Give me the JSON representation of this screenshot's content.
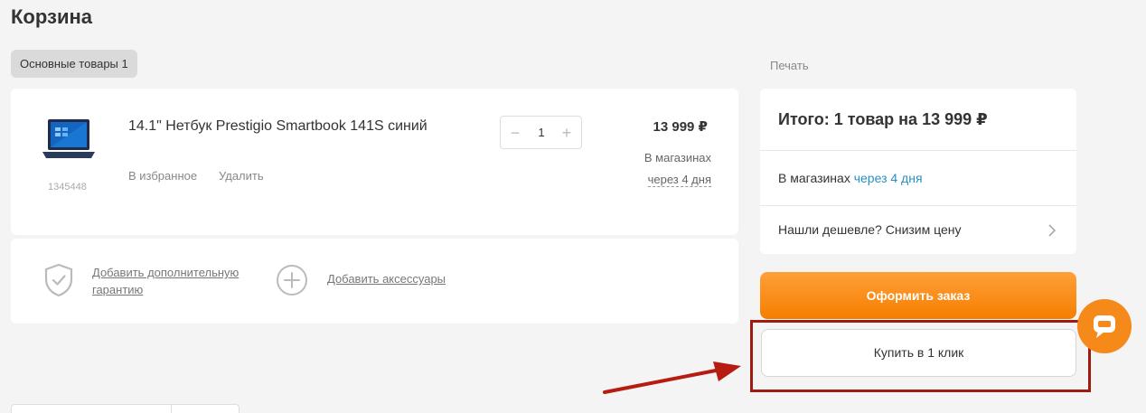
{
  "page": {
    "title": "Корзина"
  },
  "tabs": {
    "main_goods": "Основные товары 1"
  },
  "product": {
    "name": "14.1\" Нетбук Prestigio Smartbook 141S синий",
    "code": "1345448",
    "favorite_label": "В избранное",
    "delete_label": "Удалить",
    "quantity": "1",
    "minus_glyph": "−",
    "plus_glyph": "+",
    "price": "13 999 ₽",
    "availability_label": "В магазинах",
    "availability_time": "через 4 дня",
    "image_icon": "laptop-icon"
  },
  "extras": {
    "guarantee_label": "Добавить дополнительную гарантию",
    "accessories_label": "Добавить аксессуары",
    "guarantee_icon": "shield-check-icon",
    "accessories_icon": "plus-circle-icon"
  },
  "sidebar": {
    "print_label": "Печать",
    "total": "Итого: 1 товар на 13 999 ₽",
    "store_label": "В магазинах ",
    "store_time": "через 4 дня",
    "cheaper_label": "Нашли дешевле? Снизим цену",
    "order_button": "Оформить заказ",
    "one_click_button": "Купить в 1 клик"
  },
  "colors": {
    "accent_orange": "#f57e00",
    "link_blue": "#2b8fbf",
    "annotation_red": "#a11a10"
  }
}
